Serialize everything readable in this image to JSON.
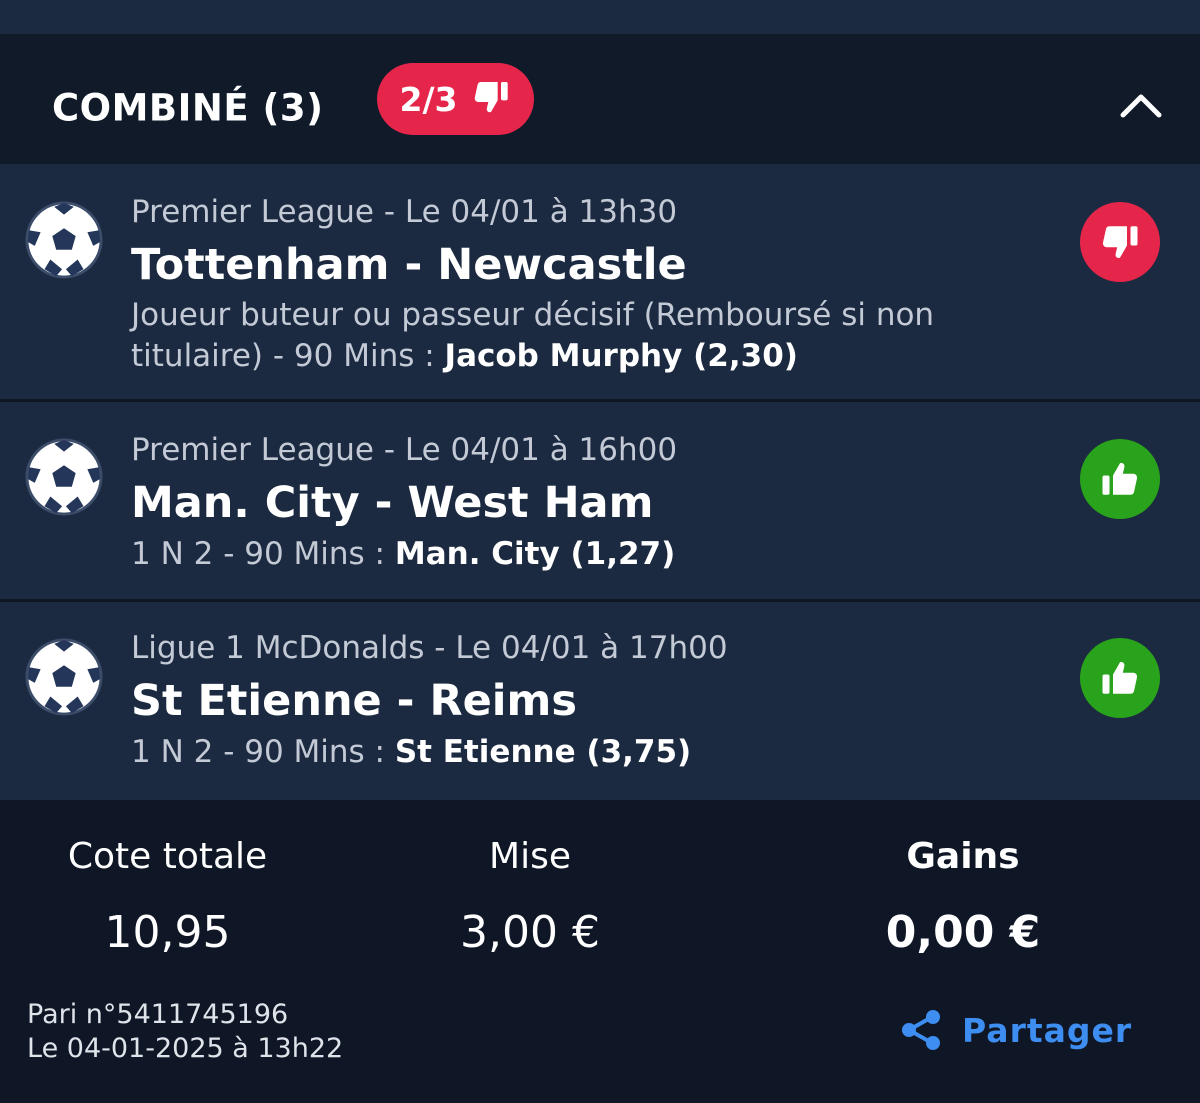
{
  "header": {
    "title": "COMBINÉ (3)",
    "badge_text": "2/3",
    "badge_color": "#e5264a"
  },
  "bets": [
    {
      "sport_icon": "soccer-ball-icon",
      "meta": "Premier League - Le 04/01 à 13h30",
      "match": "Tottenham - Newcastle",
      "market": "Joueur buteur ou passeur décisif (Remboursé si non titulaire) - 90 Mins : ",
      "selection": "Jacob Murphy (2,30)",
      "status": "lost",
      "status_icon": "thumbs-down-icon"
    },
    {
      "sport_icon": "soccer-ball-icon",
      "meta": "Premier League - Le 04/01 à 16h00",
      "match": "Man. City - West Ham",
      "market": "1 N 2 - 90 Mins : ",
      "selection": "Man. City (1,27)",
      "status": "won",
      "status_icon": "thumbs-up-icon"
    },
    {
      "sport_icon": "soccer-ball-icon",
      "meta": "Ligue 1 McDonalds - Le 04/01 à 17h00",
      "match": "St Etienne - Reims",
      "market": "1 N 2 - 90 Mins : ",
      "selection": "St Etienne (3,75)",
      "status": "won",
      "status_icon": "thumbs-up-icon"
    }
  ],
  "summary": {
    "total_odds_label": "Cote totale",
    "total_odds_value": "10,95",
    "stake_label": "Mise",
    "stake_value": "3,00 €",
    "winnings_label": "Gains",
    "winnings_value": "0,00 €"
  },
  "footer": {
    "bet_number": "Pari n°5411745196",
    "bet_date": "Le 04-01-2025 à 13h22",
    "share_label": "Partager"
  },
  "colors": {
    "lost": "#e5264a",
    "won": "#2aa31c",
    "accent": "#3d8ef0"
  }
}
